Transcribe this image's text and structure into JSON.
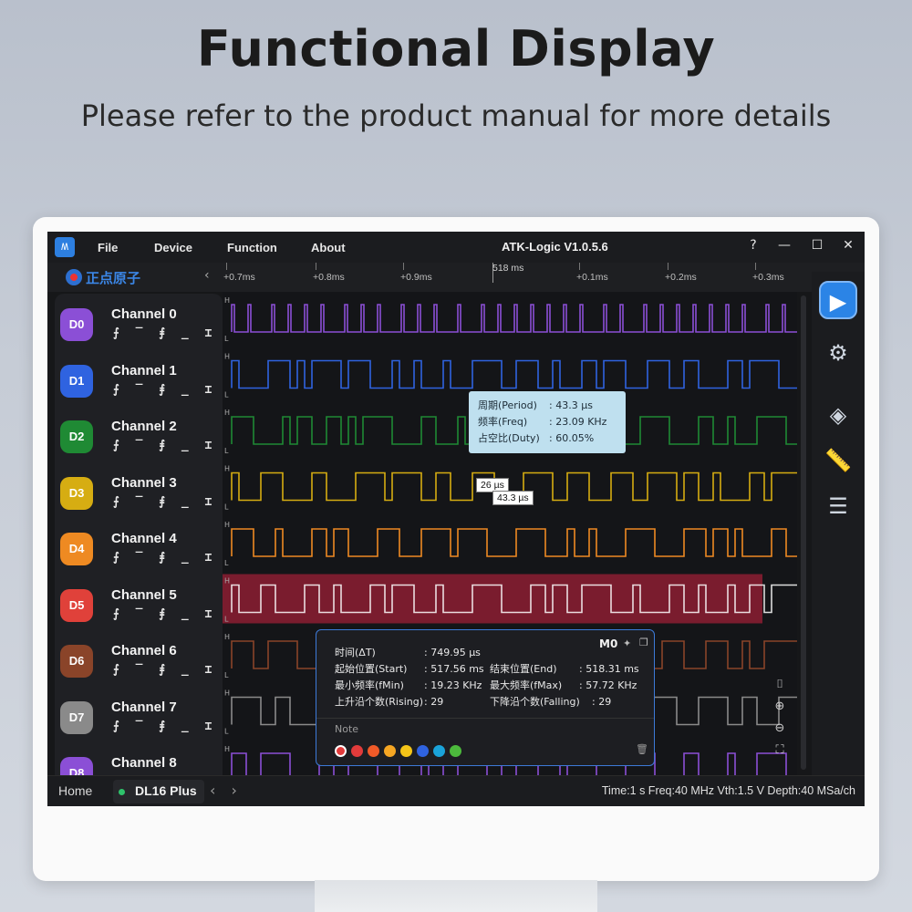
{
  "hero": {
    "title": "Functional Display",
    "subtitle": "Please refer to the product manual for more details"
  },
  "app": {
    "title": "ATK-Logic  V1.0.5.6",
    "brand": "正点原子",
    "menu": [
      "File",
      "Device",
      "Function",
      "About"
    ],
    "window_buttons": [
      "?",
      "—",
      "☐",
      "✕"
    ]
  },
  "ruler": {
    "ticks": [
      "+0.7ms",
      "+0.8ms",
      "+0.9ms",
      "+0.1ms",
      "+0.2ms",
      "+0.3ms"
    ],
    "cursor_label": "518 ms"
  },
  "channels": [
    {
      "id": "D0",
      "name": "Channel 0",
      "color": "#8b4fd6"
    },
    {
      "id": "D1",
      "name": "Channel 1",
      "color": "#2f63e0"
    },
    {
      "id": "D2",
      "name": "Channel 2",
      "color": "#1f8a34"
    },
    {
      "id": "D3",
      "name": "Channel 3",
      "color": "#d6ad12"
    },
    {
      "id": "D4",
      "name": "Channel 4",
      "color": "#ee8a22"
    },
    {
      "id": "D5",
      "name": "Channel 5",
      "color": "#e0413a"
    },
    {
      "id": "D6",
      "name": "Channel 6",
      "color": "#8a4429"
    },
    {
      "id": "D7",
      "name": "Channel 7",
      "color": "#8a8a8a"
    },
    {
      "id": "D8",
      "name": "Channel 8",
      "color": "#8b4fd6"
    }
  ],
  "trigger_symbols": "⨍ ‾ ⨎ _ ⌶",
  "measurement": {
    "period_label": "周期(Period)",
    "period_value": ": 43.3 µs",
    "freq_label": "频率(Freq)",
    "freq_value": ": 23.09 KHz",
    "duty_label": "占空比(Duty)",
    "duty_value": ": 60.05%",
    "width_label": "26 µs",
    "period_box": "43.3 µs"
  },
  "stats": {
    "marker": "M0",
    "dt_label": "时间(ΔT)",
    "dt_value": ": 749.95 µs",
    "start_label": "起始位置(Start)",
    "start_value": ": 517.56 ms",
    "end_label": "结束位置(End)",
    "end_value": ": 518.31 ms",
    "fmin_label": "最小频率(fMin)",
    "fmin_value": ": 19.23 KHz",
    "fmax_label": "最大频率(fMax)",
    "fmax_value": ": 57.72 KHz",
    "rising_label": "上升沿个数(Rising)",
    "rising_value": ": 29",
    "falling_label": "下降沿个数(Falling)",
    "falling_value": ": 29",
    "note_label": "Note",
    "note_colors": [
      "#e23b3b",
      "#e23b3b",
      "#f05a28",
      "#f5a623",
      "#f5c518",
      "#2f63e0",
      "#1aa3d9",
      "#4cba3c"
    ]
  },
  "statusbar": {
    "home": "Home",
    "device": "DL16 Plus",
    "info": "Time:1 s   Freq:40 MHz   Vth:1.5 V   Depth:40 MSa/ch"
  }
}
